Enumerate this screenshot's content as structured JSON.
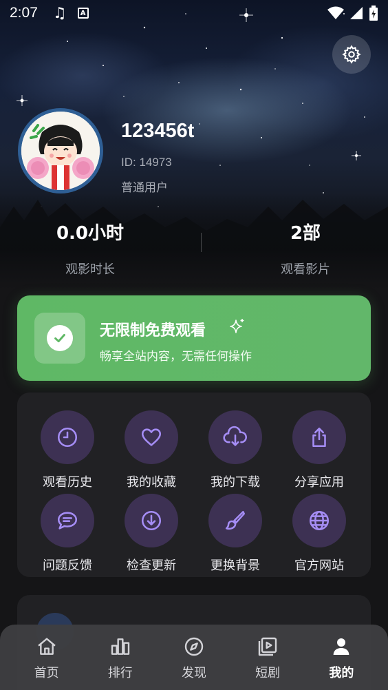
{
  "status_bar": {
    "time": "2:07",
    "a_label": "A"
  },
  "profile": {
    "username": "123456t",
    "user_id": "ID: 14973",
    "user_type": "普通用户"
  },
  "stats": [
    {
      "value": "0.0小时",
      "label": "观影时长"
    },
    {
      "value": "2部",
      "label": "观看影片"
    }
  ],
  "vip": {
    "title": "无限制免费观看",
    "subtitle": "畅享全站内容，无需任何操作",
    "accent": "#5fb865"
  },
  "features": [
    {
      "label": "观看历史",
      "icon": "clock-icon"
    },
    {
      "label": "我的收藏",
      "icon": "heart-icon"
    },
    {
      "label": "我的下载",
      "icon": "cloud-download-icon"
    },
    {
      "label": "分享应用",
      "icon": "share-icon"
    },
    {
      "label": "问题反馈",
      "icon": "chat-icon"
    },
    {
      "label": "检查更新",
      "icon": "download-circle-icon"
    },
    {
      "label": "更换背景",
      "icon": "brush-icon"
    },
    {
      "label": "官方网站",
      "icon": "globe-icon"
    }
  ],
  "feature_icon_color": "#a58df5",
  "bottom_nav": [
    {
      "label": "首页",
      "icon": "home-icon"
    },
    {
      "label": "排行",
      "icon": "ranking-icon"
    },
    {
      "label": "发现",
      "icon": "compass-icon"
    },
    {
      "label": "短剧",
      "icon": "short-drama-icon"
    },
    {
      "label": "我的",
      "icon": "person-icon",
      "active": true
    }
  ]
}
